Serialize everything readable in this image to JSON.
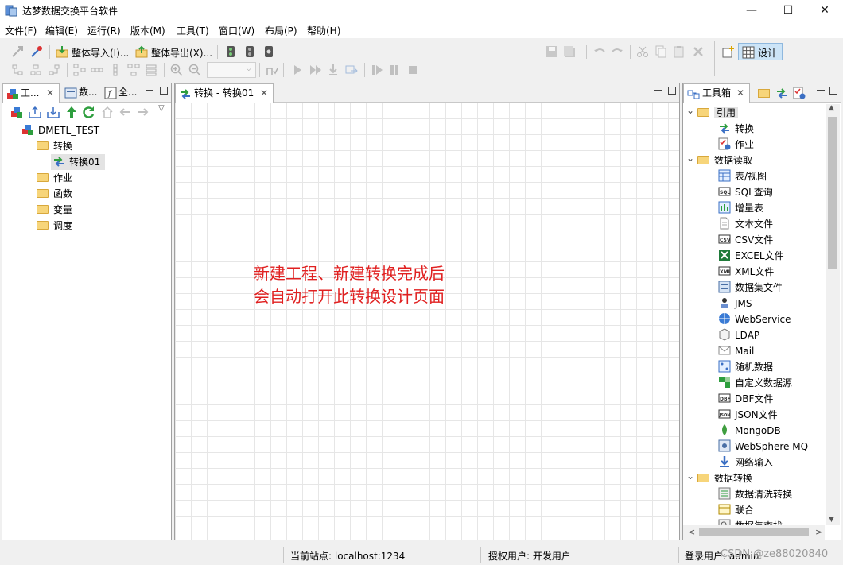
{
  "window": {
    "title": "达梦数据交换平台软件",
    "controls": {
      "minimize": "—",
      "maximize": "☐",
      "close": "✕"
    }
  },
  "menu": [
    "文件(F)",
    "编辑(E)",
    "运行(R)",
    "版本(M)",
    "工具(T)",
    "窗口(W)",
    "布局(P)",
    "帮助(H)"
  ],
  "toolbar": {
    "import_all": "整体导入(I)...",
    "export_all": "整体导出(X)...",
    "design": "设计"
  },
  "left_panel": {
    "tabs": [
      "工...",
      "数...",
      "全..."
    ],
    "tree": {
      "root": "DMETL_TEST",
      "folders": [
        "转换",
        "作业",
        "函数",
        "变量",
        "调度"
      ],
      "selected_child": "转换01"
    }
  },
  "editor": {
    "tab_label": "转换 - 转换01",
    "note_line1": "新建工程、新建转换完成后",
    "note_line2": "会自动打开此转换设计页面"
  },
  "toolbox": {
    "tab_label": "工具箱",
    "groups": [
      {
        "label": "引用",
        "items": [
          "转换",
          "作业"
        ]
      },
      {
        "label": "数据读取",
        "items": [
          "表/视图",
          "SQL查询",
          "增量表",
          "文本文件",
          "CSV文件",
          "EXCEL文件",
          "XML文件",
          "数据集文件",
          "JMS",
          "WebService",
          "LDAP",
          "Mail",
          "随机数据",
          "自定义数据源",
          "DBF文件",
          "JSON文件",
          "MongoDB",
          "WebSphere MQ",
          "网络输入"
        ]
      },
      {
        "label": "数据转换",
        "items": [
          "数据清洗转换",
          "联合",
          "数据集查找"
        ]
      }
    ]
  },
  "status": {
    "site": "当前站点: localhost:1234",
    "auth_user": "授权用户: 开发用户",
    "login_user": "登录用户: admin",
    "watermark": "CSDN @ze88020840"
  },
  "colors": {
    "note": "#e02020",
    "design_active": "#cce4f7"
  }
}
